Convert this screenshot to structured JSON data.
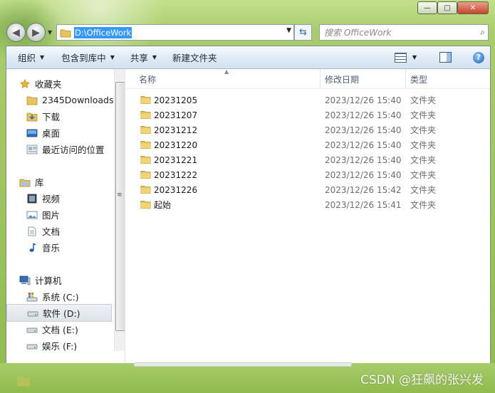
{
  "window": {
    "caption_buttons": {
      "minimize": "—",
      "maximize": "□",
      "close": "✕"
    }
  },
  "address": {
    "path": "D:\\OfficeWork",
    "search_placeholder": "搜索 OfficeWork"
  },
  "toolbar": {
    "organize": "组织",
    "include_in_library": "包含到库中",
    "share": "共享",
    "new_folder": "新建文件夹",
    "help": "?"
  },
  "sidebar": {
    "favorites": {
      "title": "收藏夹",
      "items": [
        "2345Downloads",
        "下载",
        "桌面",
        "最近访问的位置"
      ]
    },
    "libraries": {
      "title": "库",
      "items": [
        "视频",
        "图片",
        "文档",
        "音乐"
      ]
    },
    "computer": {
      "title": "计算机",
      "items": [
        "系统 (C:)",
        "软件 (D:)",
        "文档 (E:)",
        "娱乐 (F:)"
      ],
      "selected": "软件 (D:)"
    }
  },
  "columns": {
    "name": "名称",
    "date": "修改日期",
    "type": "类型"
  },
  "files": [
    {
      "name": "20231205",
      "date": "2023/12/26 15:40",
      "type": "文件夹"
    },
    {
      "name": "20231207",
      "date": "2023/12/26 15:40",
      "type": "文件夹"
    },
    {
      "name": "20231212",
      "date": "2023/12/26 15:40",
      "type": "文件夹"
    },
    {
      "name": "20231220",
      "date": "2023/12/26 15:40",
      "type": "文件夹"
    },
    {
      "name": "20231221",
      "date": "2023/12/26 15:40",
      "type": "文件夹"
    },
    {
      "name": "20231222",
      "date": "2023/12/26 15:40",
      "type": "文件夹"
    },
    {
      "name": "20231226",
      "date": "2023/12/26 15:42",
      "type": "文件夹"
    },
    {
      "name": "起始",
      "date": "2023/12/26 15:41",
      "type": "文件夹"
    }
  ],
  "watermark": "CSDN @狂飙的张兴发",
  "colors": {
    "selection": "#3399ff",
    "glass": "#9cc35c",
    "folder": "#e8c45a"
  }
}
